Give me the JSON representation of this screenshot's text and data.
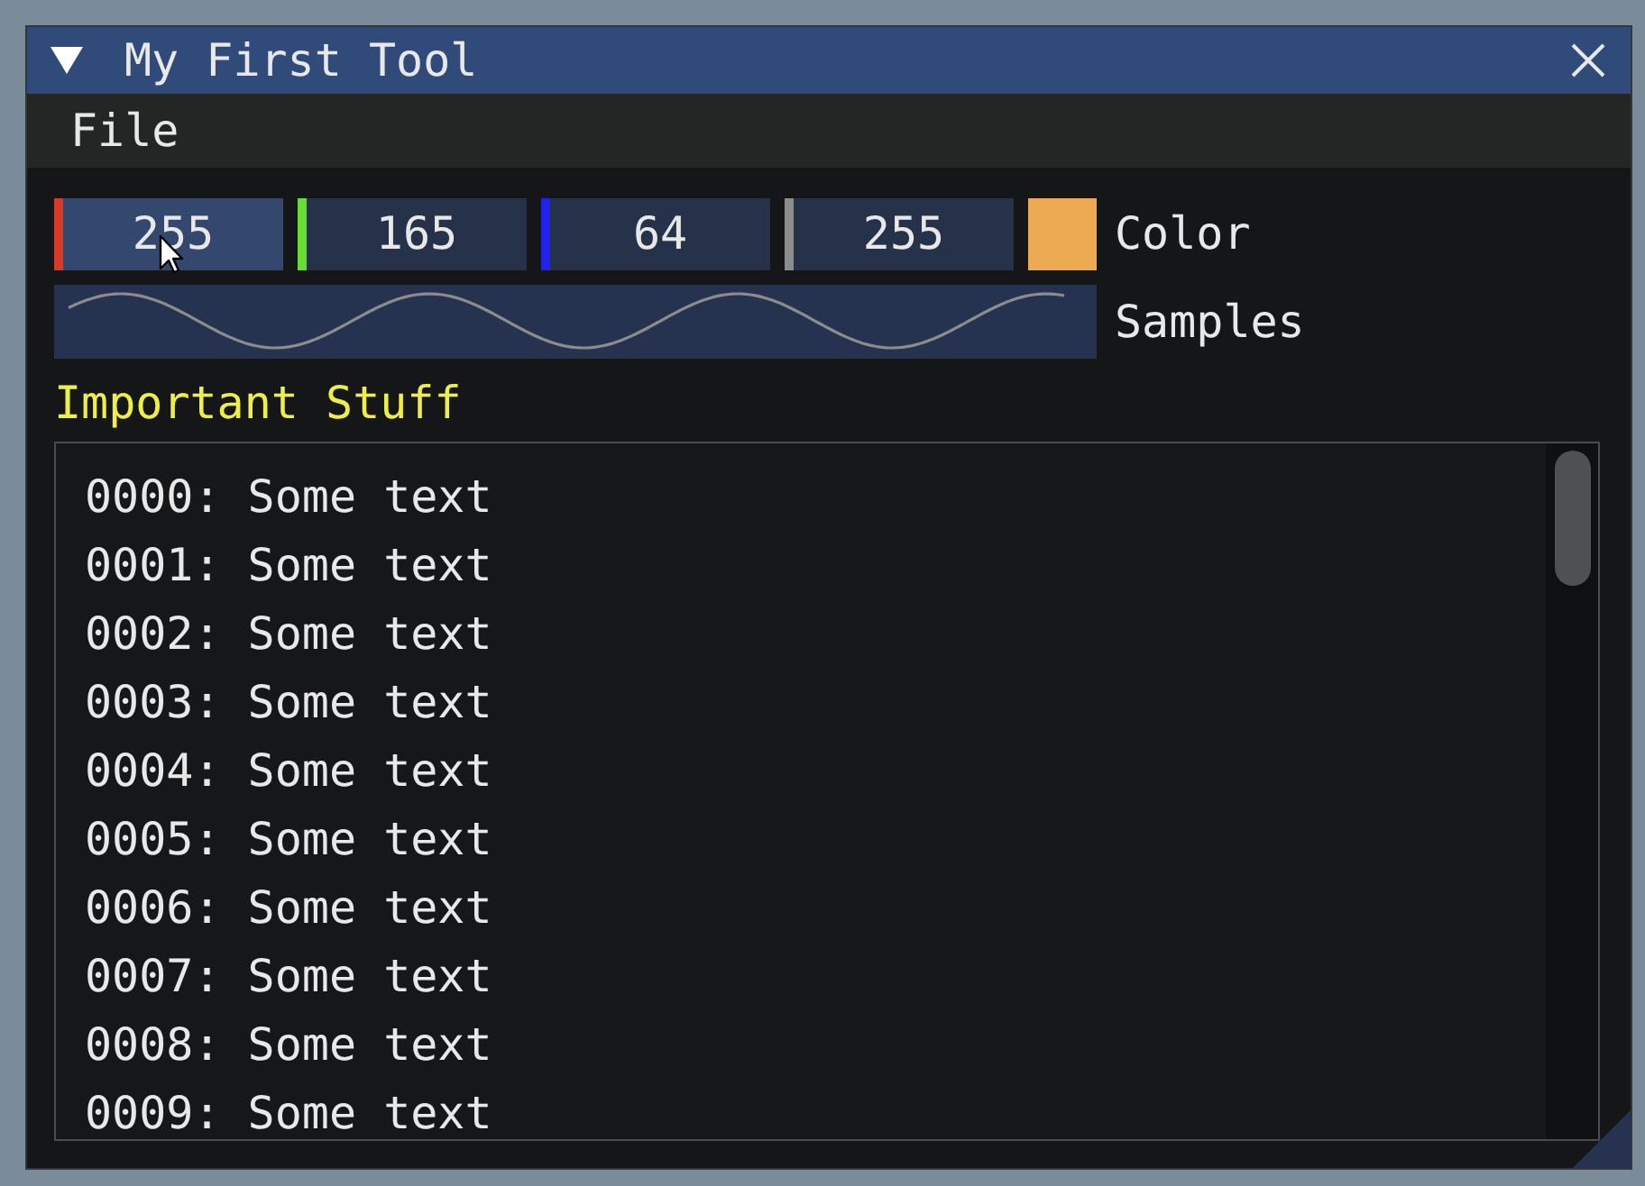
{
  "window": {
    "title": "My First Tool"
  },
  "menu_bar": [
    {
      "label": "File"
    }
  ],
  "color_edit": {
    "channels": [
      {
        "value": "255",
        "color": "#d83a28",
        "hovered": true
      },
      {
        "value": "165",
        "color": "#66dd33",
        "hovered": false
      },
      {
        "value": "64",
        "color": "#2222ee",
        "hovered": false
      },
      {
        "value": "255",
        "color": "#8c8c8c",
        "hovered": false
      }
    ],
    "swatch": {
      "color": "#eeaa52"
    },
    "label": "Color"
  },
  "samples": {
    "label": "Samples"
  },
  "section": {
    "heading": "Important Stuff",
    "lines": [
      "0000: Some text",
      "0001: Some text",
      "0002: Some text",
      "0003: Some text",
      "0004: Some text",
      "0005: Some text",
      "0006: Some text",
      "0007: Some text",
      "0008: Some text",
      "0009: Some text"
    ]
  }
}
